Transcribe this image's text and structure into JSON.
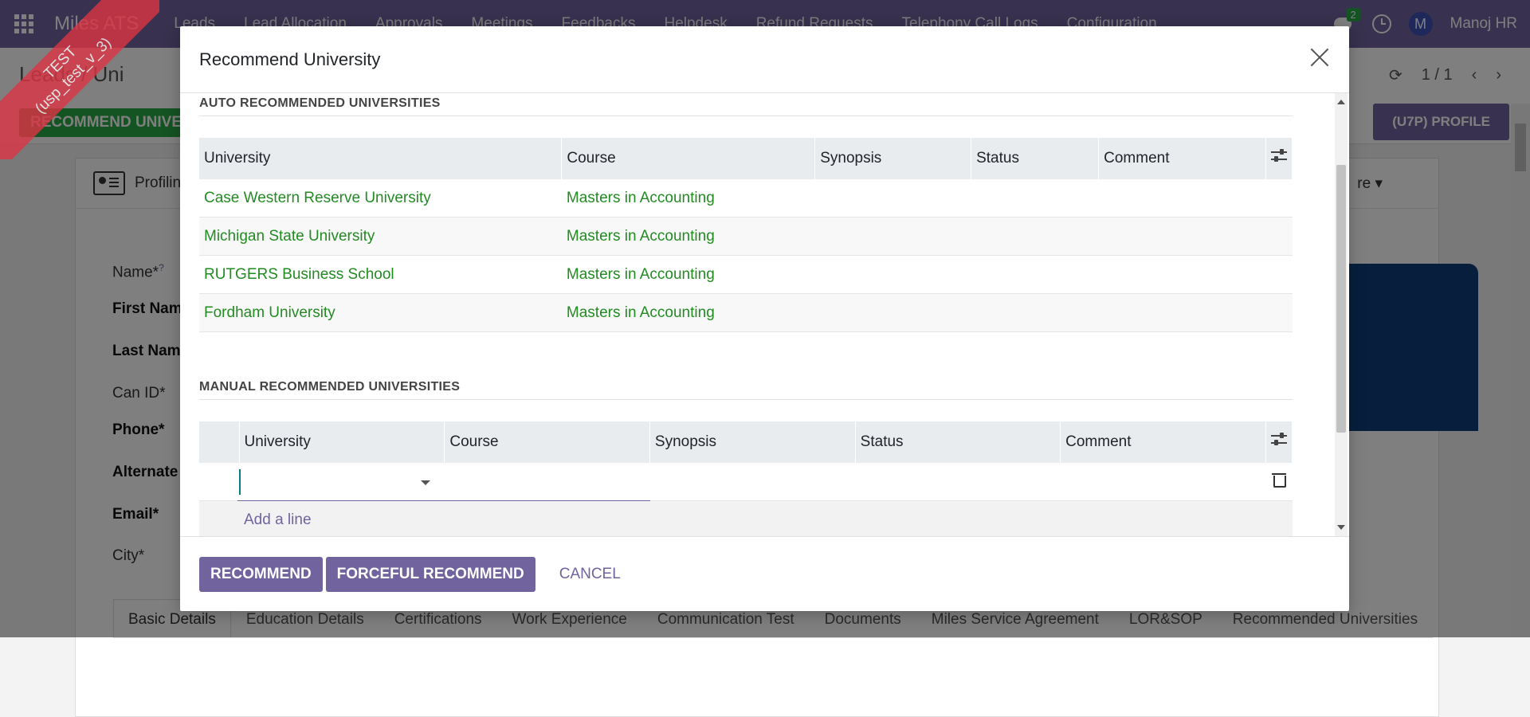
{
  "navbar": {
    "brand": "Miles ATS",
    "menu": [
      "Leads",
      "Lead Allocation",
      "Approvals",
      "Meetings",
      "Feedbacks",
      "Helpdesk",
      "Refund Requests",
      "Telephony Call Logs",
      "Configuration"
    ],
    "chat_badge": "2",
    "avatar_letter": "M",
    "user_name": "Manoj HR"
  },
  "ribbon": {
    "line1": "TEST",
    "line2": "(usp_test_v_3)"
  },
  "control_panel": {
    "breadcrumb": "Leads / Uni",
    "pager": "1 / 1",
    "recommend_btn": "RECOMMEND UNIVE",
    "profile_btn": "(U7P) PROFILE"
  },
  "sheet": {
    "header_label": "Profilin",
    "more_label": "re",
    "fields": [
      "Name*",
      "First Nam",
      "Last Name",
      "Can ID*",
      "Phone*",
      "Alternate",
      "Email*",
      "City*"
    ],
    "name_help": "?",
    "tabs": [
      "Basic Details",
      "Education Details",
      "Certifications",
      "Work Experience",
      "Communication Test",
      "Documents",
      "Miles Service Agreement",
      "LOR&SOP",
      "Recommended Universities"
    ]
  },
  "modal": {
    "title": "Recommend University",
    "auto_section": {
      "title": "AUTO RECOMMENDED UNIVERSITIES",
      "columns": [
        "University",
        "Course",
        "Synopsis",
        "Status",
        "Comment"
      ],
      "rows": [
        {
          "university": "Case Western Reserve University",
          "course": "Masters in Accounting"
        },
        {
          "university": "Michigan State University",
          "course": "Masters in Accounting"
        },
        {
          "university": "RUTGERS Business School",
          "course": "Masters in Accounting"
        },
        {
          "university": "Fordham University",
          "course": "Masters in Accounting"
        }
      ]
    },
    "manual_section": {
      "title": "MANUAL RECOMMENDED UNIVERSITIES",
      "columns": [
        "University",
        "Course",
        "Synopsis",
        "Status",
        "Comment"
      ],
      "university_input_value": "",
      "add_line": "Add a line"
    },
    "footer": {
      "recommend": "RECOMMEND",
      "forceful": "FORCEFUL RECOMMEND",
      "cancel": "CANCEL"
    }
  }
}
